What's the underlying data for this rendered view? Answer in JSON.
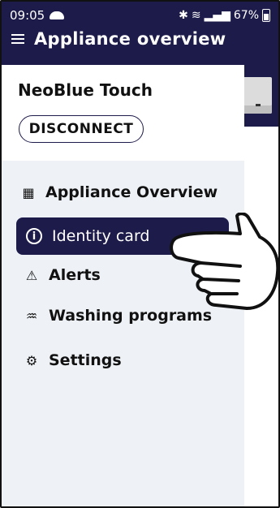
{
  "status_bar": {
    "time": "09:05",
    "battery": "67%"
  },
  "app_bar": {
    "title": "Appliance overview"
  },
  "drawer": {
    "device_name": "NeoBlue Touch",
    "disconnect_label": "DISCONNECT",
    "menu": [
      {
        "label": "Appliance Overview",
        "icon": "grid-icon"
      },
      {
        "label": "Identity card",
        "icon": "info-icon",
        "selected": true
      },
      {
        "label": "Alerts",
        "icon": "warning-icon"
      },
      {
        "label": "Washing programs",
        "icon": "washing-program-icon"
      },
      {
        "label": "Settings",
        "icon": "gear-icon"
      }
    ]
  },
  "colors": {
    "primary": "#1d1b4a",
    "menu_background": "#eef2f6"
  }
}
